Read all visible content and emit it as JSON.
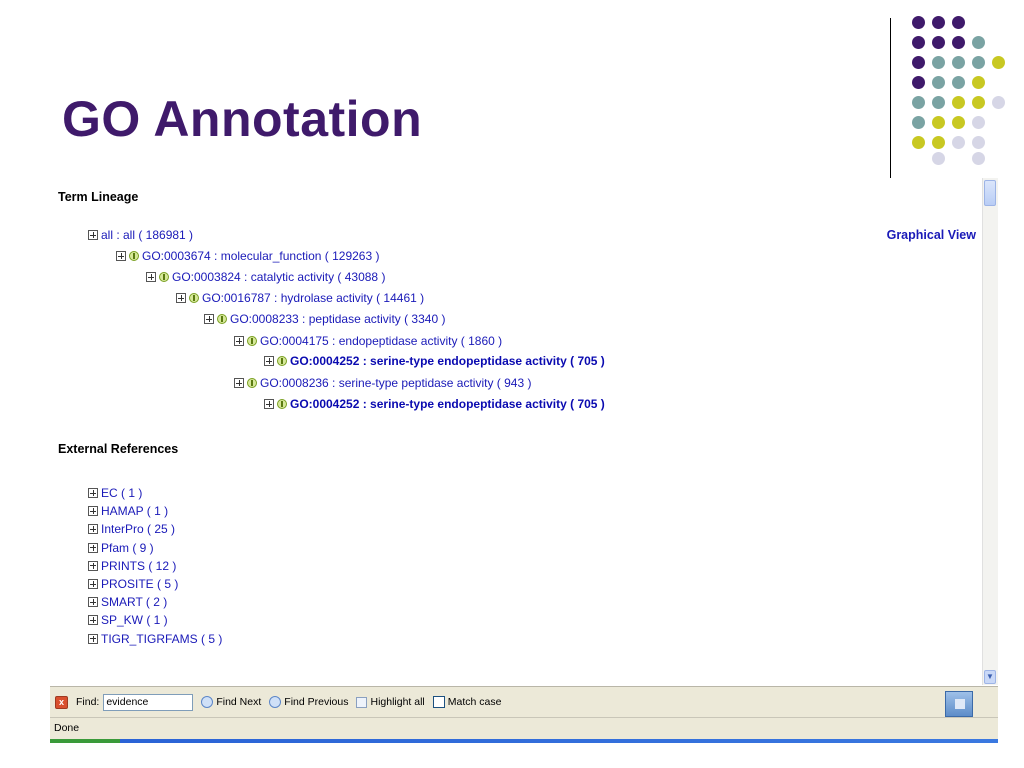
{
  "slide": {
    "title": "GO Annotation",
    "accent_color": "#3f1a6b"
  },
  "decoration": {
    "dot_colors": [
      "#3f1a6b",
      "#7aa3a3",
      "#c8c822",
      "#d6d6e6"
    ]
  },
  "term_lineage": {
    "heading": "Term Lineage",
    "graphical_view_label": "Graphical View",
    "rows": [
      {
        "text": "all : all ( 186981 )",
        "bold": false,
        "go_icon": false
      },
      {
        "text": "GO:0003674 : molecular_function ( 129263 )",
        "bold": false,
        "go_icon": true
      },
      {
        "text": "GO:0003824 : catalytic activity ( 43088 )",
        "bold": false,
        "go_icon": true
      },
      {
        "text": "GO:0016787 : hydrolase activity ( 14461 )",
        "bold": false,
        "go_icon": true
      },
      {
        "text": "GO:0008233 : peptidase activity ( 3340 )",
        "bold": false,
        "go_icon": true
      },
      {
        "text": "GO:0004175 : endopeptidase activity ( 1860 )",
        "bold": false,
        "go_icon": true
      },
      {
        "text": "GO:0004252 : serine-type endopeptidase activity ( 705 )",
        "bold": true,
        "go_icon": true
      },
      {
        "text": "GO:0008236 : serine-type peptidase activity ( 943 )",
        "bold": false,
        "go_icon": true
      },
      {
        "text": "GO:0004252 : serine-type endopeptidase activity ( 705 )",
        "bold": true,
        "go_icon": true
      }
    ]
  },
  "external_references": {
    "heading": "External References",
    "items": [
      "EC ( 1 )",
      "HAMAP ( 1 )",
      "InterPro ( 25 )",
      "Pfam ( 9 )",
      "PRINTS ( 12 )",
      "PROSITE ( 5 )",
      "SMART ( 2 )",
      "SP_KW ( 1 )",
      "TIGR_TIGRFAMS ( 5 )"
    ]
  },
  "find_bar": {
    "close_glyph": "x",
    "label": "Find:",
    "value": "evidence",
    "find_next": "Find Next",
    "find_previous": "Find Previous",
    "highlight_all": "Highlight all",
    "match_case": "Match case"
  },
  "status_bar": {
    "text": "Done"
  }
}
